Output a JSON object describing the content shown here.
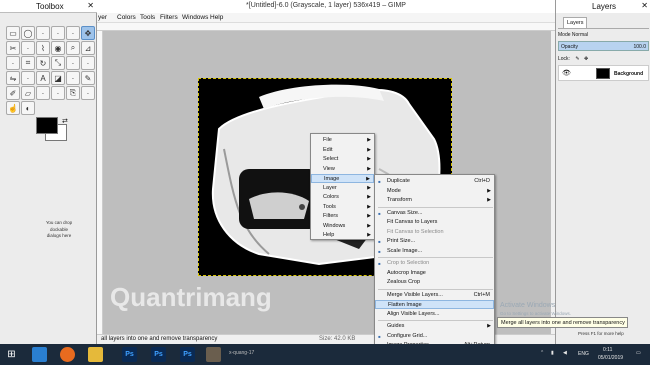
{
  "toolbox": {
    "title": "Toolbox",
    "tools": [
      "rect-select-icon",
      "ellipse-select-icon",
      "free-select-icon",
      "fuzzy-select-icon",
      "color-select-icon",
      "move-icon",
      "scissors-icon",
      "foreground-select-icon",
      "paths-icon",
      "color-picker-icon",
      "zoom-icon",
      "measure-icon",
      "align-icon",
      "crop-icon",
      "rotate-icon",
      "scale-icon",
      "shear-icon",
      "perspective-icon",
      "flip-icon",
      "cage-icon",
      "text-icon",
      "bucket-fill-icon",
      "blend-icon",
      "pencil-icon",
      "paintbrush-icon",
      "eraser-icon",
      "airbrush-icon",
      "ink-icon",
      "clone-icon",
      "heal-icon",
      "smudge-icon",
      "dodge-icon"
    ],
    "selected_tool_index": 5,
    "drop_note": "You can drop dockable dialogs here"
  },
  "window": {
    "title": "*[Untitled]-6.0 (Grayscale, 1 layer) 536x419 – GIMP"
  },
  "menubar": [
    "yer",
    "Colors",
    "Tools",
    "Filters",
    "Windows",
    "Help"
  ],
  "status": {
    "message": "all layers into one and remove transparency",
    "size": "Size: 42.0 KB"
  },
  "layers_panel": {
    "title": "Layers",
    "tab": "Layers",
    "mode_label": "Mode",
    "mode_value": "Normal",
    "opacity_label": "Opacity",
    "opacity_value": "100.0",
    "lock_label": "Lock:",
    "layer_name": "Background"
  },
  "menu_main": [
    {
      "label": "File",
      "sub": true
    },
    {
      "label": "Edit",
      "sub": true
    },
    {
      "label": "Select",
      "sub": true
    },
    {
      "label": "View",
      "sub": true
    },
    {
      "label": "Image",
      "sub": true,
      "active": true
    },
    {
      "label": "Layer",
      "sub": true
    },
    {
      "label": "Colors",
      "sub": true
    },
    {
      "label": "Tools",
      "sub": true
    },
    {
      "label": "Filters",
      "sub": true
    },
    {
      "label": "Windows",
      "sub": true
    },
    {
      "label": "Help",
      "sub": true
    }
  ],
  "menu_image": [
    {
      "label": "Duplicate",
      "shortcut": "Ctrl+D",
      "icon": "duplicate-icon"
    },
    {
      "label": "Mode",
      "sub": true
    },
    {
      "label": "Transform",
      "sub": true
    },
    {
      "sep": true
    },
    {
      "label": "Canvas Size...",
      "icon": "canvas-size-icon"
    },
    {
      "label": "Fit Canvas to Layers"
    },
    {
      "label": "Fit Canvas to Selection",
      "disabled": true
    },
    {
      "label": "Print Size...",
      "icon": "print-size-icon"
    },
    {
      "label": "Scale Image...",
      "icon": "scale-image-icon"
    },
    {
      "sep": true
    },
    {
      "label": "Crop to Selection",
      "disabled": true,
      "icon": "crop-icon"
    },
    {
      "label": "Autocrop Image"
    },
    {
      "label": "Zealous Crop"
    },
    {
      "sep": true
    },
    {
      "label": "Merge Visible Layers...",
      "shortcut": "Ctrl+M"
    },
    {
      "label": "Flatten Image",
      "active": true
    },
    {
      "label": "Align Visible Layers..."
    },
    {
      "sep": true
    },
    {
      "label": "Guides",
      "sub": true
    },
    {
      "label": "Configure Grid...",
      "icon": "grid-icon"
    },
    {
      "label": "Image Properties",
      "shortcut": "Alt+Return",
      "icon": "info-icon"
    }
  ],
  "tooltip": "Merge all layers into one and remove transparency",
  "press_f1": "Press F1 for more help",
  "watermark": {
    "brand": "Quantrimang",
    "activate": "Activate Windows",
    "activate_sub": "Go to Settings to activate Windows."
  },
  "taskbar": {
    "apps": [
      "start-icon",
      "ie-icon",
      "firefox-icon",
      "explorer-icon",
      "photoshop-icon",
      "photoshop-icon",
      "photoshop-icon",
      "gimp-icon"
    ],
    "gimp_label": "x-quang-17",
    "lang": "ENG",
    "time": "0:11",
    "date": "05/01/2019"
  },
  "colors": {
    "taskbar": "#1b2a3b",
    "highlight": "#cfe3f8",
    "selection_border": "#d8c400"
  }
}
